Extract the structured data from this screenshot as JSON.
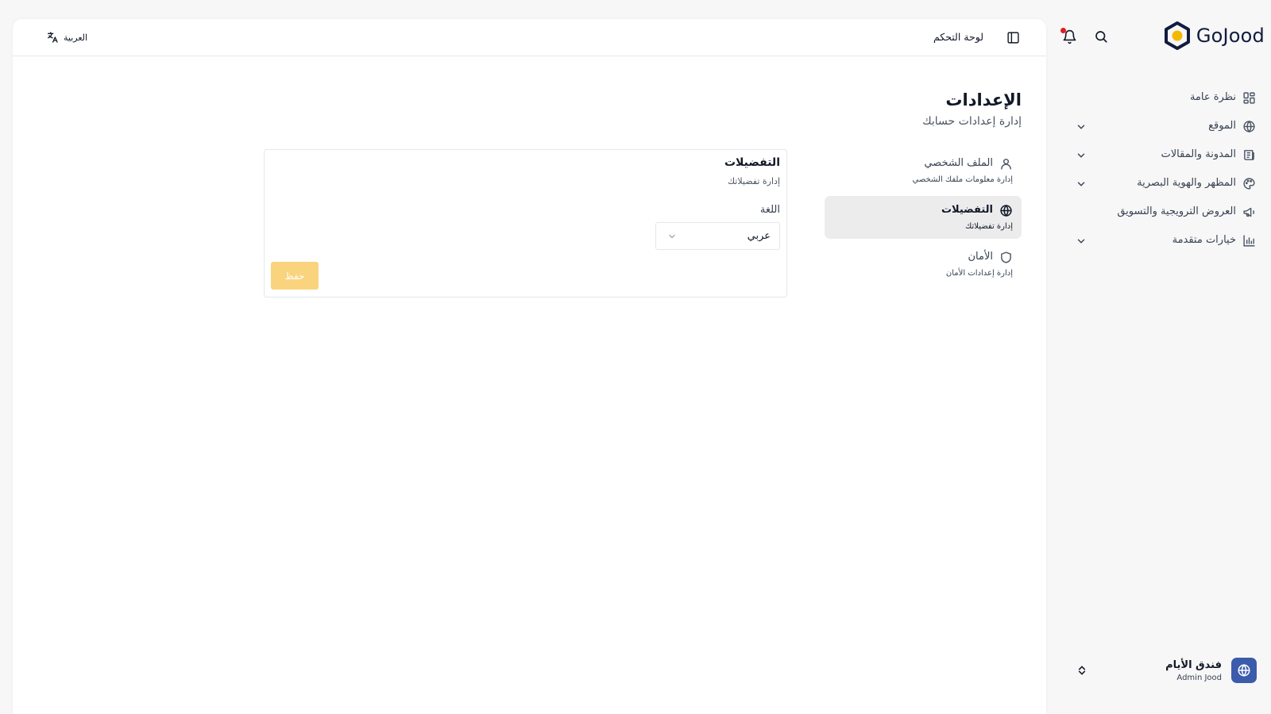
{
  "brand": {
    "name": "GoJood",
    "accent_color": "#f5b800",
    "logo_color": "#111c3d"
  },
  "header_icons": [
    "search-icon",
    "bell-icon"
  ],
  "notification_dot_color": "#e11d1d",
  "sidebar": {
    "items": [
      {
        "label": "نظرة عامة",
        "icon": "grid-icon",
        "has_chevron": false
      },
      {
        "label": "الموقع",
        "icon": "globe-icon",
        "has_chevron": true
      },
      {
        "label": "المدونة والمقالات",
        "icon": "newspaper-icon",
        "has_chevron": true
      },
      {
        "label": "المظهر والهوية البصرية",
        "icon": "palette-icon",
        "has_chevron": true
      },
      {
        "label": "العروض الترويجية والتسويق",
        "icon": "megaphone-icon",
        "has_chevron": false
      },
      {
        "label": "خيارات متقدمة",
        "icon": "bar-chart-icon",
        "has_chevron": true
      }
    ]
  },
  "account": {
    "name": "فندق الأيام",
    "subtitle": "Admin Jood",
    "avatar_color": "#3b5bab"
  },
  "topbar": {
    "title": "لوحة التحكم",
    "language_label": "العربية"
  },
  "page": {
    "title": "الإعدادات",
    "subtitle": "إدارة إعدادات حسابك"
  },
  "settings_nav": [
    {
      "label": "الملف الشخصي",
      "description": "إدارة معلومات ملفك الشخصي",
      "icon": "user-icon",
      "active": false
    },
    {
      "label": "التفضيلات",
      "description": "إدارة تفضيلاتك",
      "icon": "globe-icon",
      "active": true
    },
    {
      "label": "الأمان",
      "description": "إدارة إعدادات الأمان",
      "icon": "shield-icon",
      "active": false
    }
  ],
  "preferences_card": {
    "title": "التفضيلات",
    "description": "إدارة تفضيلاتك",
    "language_field_label": "اللغة",
    "language_value": "عربي",
    "save_label": "حفظ",
    "save_button_color": "#f9d37d"
  }
}
